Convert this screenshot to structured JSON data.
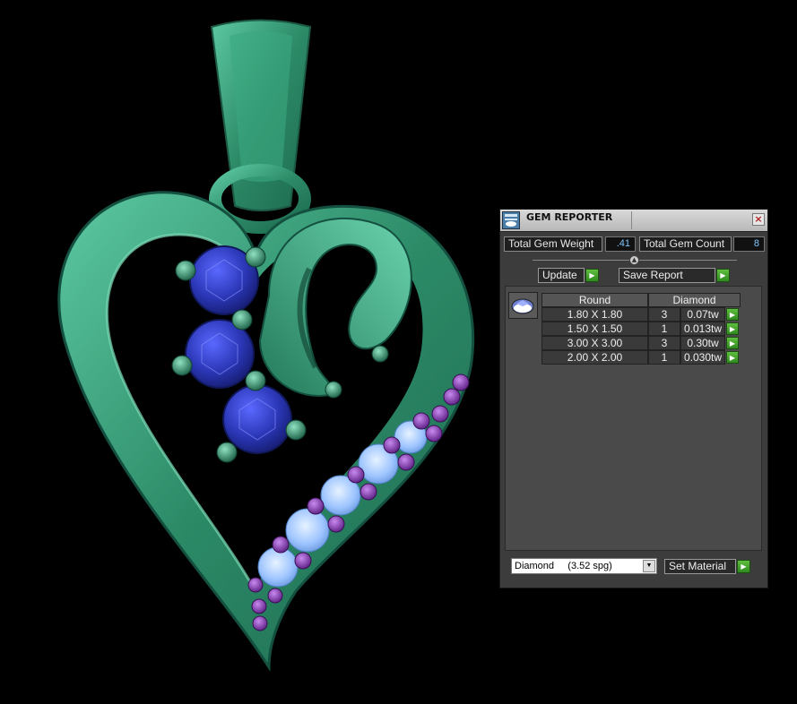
{
  "panel": {
    "title": "GEM REPORTER",
    "close_symbol": "×",
    "total_weight_label": "Total Gem Weight",
    "total_weight_value": ".41",
    "total_count_label": "Total Gem Count",
    "total_count_value": "8",
    "update_label": "Update",
    "save_report_label": "Save Report",
    "go_symbol": "▶",
    "divider_knob_symbol": "▲",
    "table": {
      "headers": [
        "Round",
        "Diamond"
      ],
      "rows": [
        {
          "size": "1.80 X 1.80",
          "count": "3",
          "weight": "0.07tw"
        },
        {
          "size": "1.50 X 1.50",
          "count": "1",
          "weight": "0.013tw"
        },
        {
          "size": "3.00 X 3.00",
          "count": "3",
          "weight": "0.30tw"
        },
        {
          "size": "2.00 X 2.00",
          "count": "1",
          "weight": "0.030tw"
        }
      ]
    },
    "material_select_value": "Diamond     (3.52 spg)",
    "material_select_arrow": "▼",
    "set_material_label": "Set Material"
  },
  "icons": {
    "title_icon": "gem-report-icon",
    "thumb_icon": "round-diamond-icon",
    "go_icon": "green-arrow-icon"
  },
  "colors": {
    "metal": "#2e8a68",
    "metal_light": "#57c7a0",
    "sapphire": "#2f3db8",
    "diamond": "#9bc6ff",
    "amethyst": "#8a3fb0",
    "go_button": "#4aa82f"
  }
}
